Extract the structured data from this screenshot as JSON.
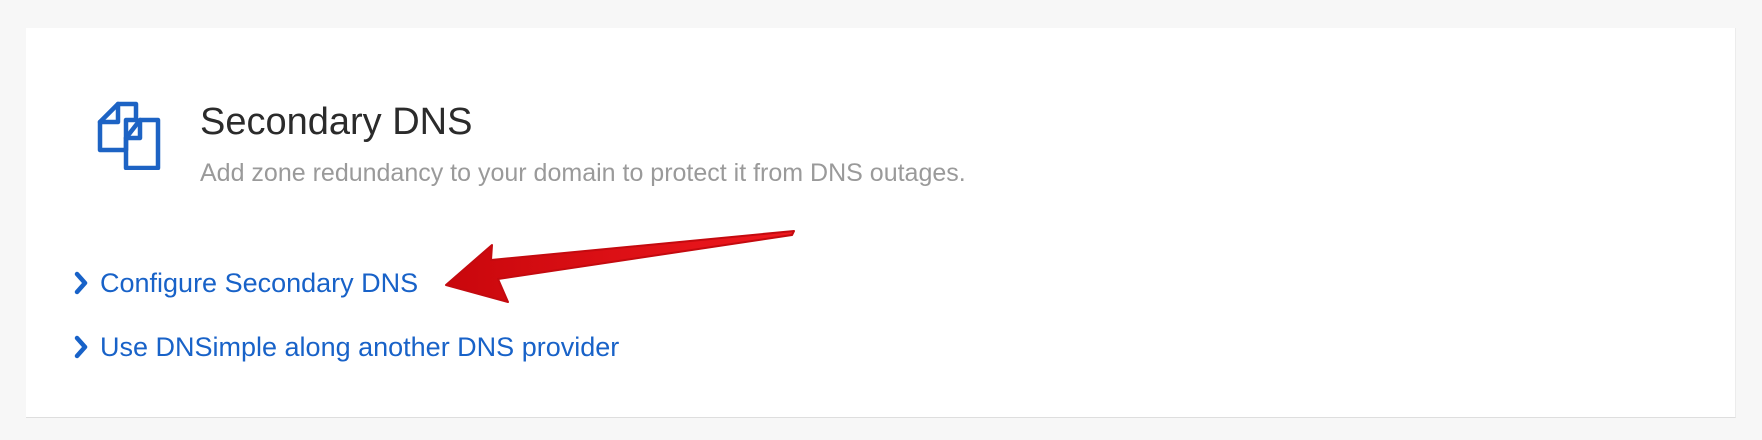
{
  "service": {
    "icon": "duplicate-pages-icon",
    "title": "Secondary DNS",
    "description": "Add zone redundancy to your domain to protect it from DNS outages."
  },
  "links": [
    {
      "icon": "chevron-right-icon",
      "label": "Configure Secondary DNS"
    },
    {
      "icon": "chevron-right-icon",
      "label": "Use DNSimple along another DNS provider"
    }
  ],
  "annotation": {
    "icon": "red-arrow-icon",
    "target": "Configure Secondary DNS",
    "color": "#e8161b"
  },
  "colors": {
    "accent": "#1862c8",
    "title": "#2b2b2b",
    "description": "#9a9a9a",
    "background": "#f7f7f7",
    "card": "#ffffff"
  }
}
